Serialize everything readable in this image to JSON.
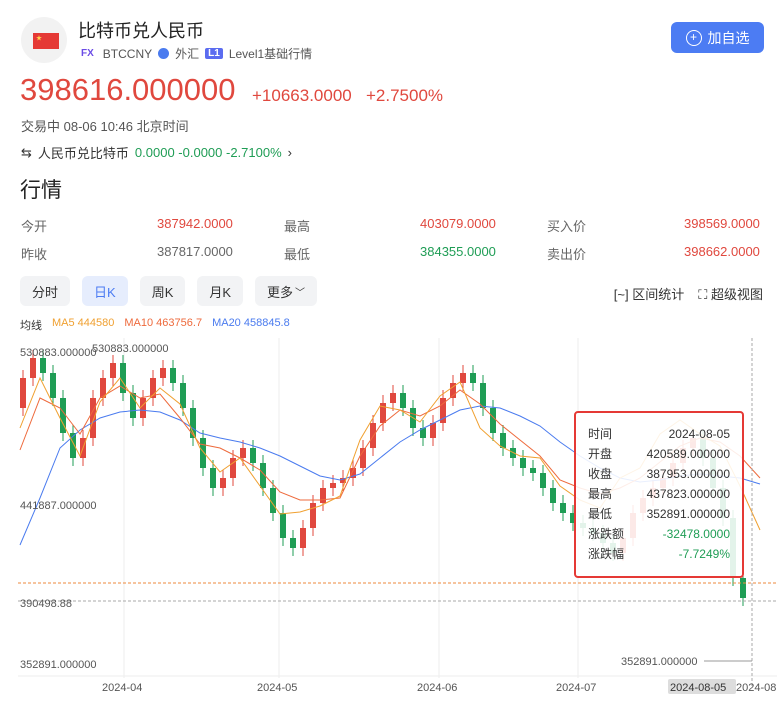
{
  "header": {
    "title": "比特币兑人民币",
    "fx_badge": "FX",
    "symbol": "BTCCNY",
    "market": "外汇",
    "level_badge": "L1",
    "level": "Level1基础行情",
    "add_label": "加自选"
  },
  "quote": {
    "price": "398616.000000",
    "change": "+10663.0000",
    "change_pct": "+2.7500%",
    "status": "交易中 08-06 10:46 北京时间",
    "inverse_label": "人民币兑比特币",
    "inverse_values": "0.0000 -0.0000 -2.7100%"
  },
  "section_title": "行情",
  "stats": [
    {
      "label": "今开",
      "value": "387942.0000",
      "color": "red"
    },
    {
      "label": "最高",
      "value": "403079.0000",
      "color": "red"
    },
    {
      "label": "买入价",
      "value": "398569.0000",
      "color": "red"
    },
    {
      "label": "昨收",
      "value": "387817.0000",
      "color": "gray"
    },
    {
      "label": "最低",
      "value": "384355.0000",
      "color": "green"
    },
    {
      "label": "卖出价",
      "value": "398662.0000",
      "color": "red"
    }
  ],
  "tabs": [
    "分时",
    "日K",
    "周K",
    "月K",
    "更多"
  ],
  "tools": {
    "range": "区间统计",
    "super": "超级视图"
  },
  "ma": {
    "label": "均线",
    "ma5": "MA5 444580",
    "ma10": "MA10 463756.7",
    "ma20": "MA20 458845.8",
    "colors": {
      "ma5": "#f0a030",
      "ma10": "#ee6a3c",
      "ma20": "#4a7bef"
    }
  },
  "axis": {
    "y_top": "530883.000000",
    "y_top_mark": "530883.000000",
    "y_mid": "441887.000000",
    "y_current": "390498.88",
    "y_bottom": "352891.000000",
    "low_mark": "352891.000000",
    "x_ticks": [
      "2024-04",
      "2024-05",
      "2024-06",
      "2024-07",
      "2024-08"
    ],
    "cursor_date": "2024-08-05"
  },
  "tooltip": [
    {
      "label": "时间",
      "value": "2024-08-05",
      "color": "dark"
    },
    {
      "label": "开盘",
      "value": "420589.000000",
      "color": "dark"
    },
    {
      "label": "收盘",
      "value": "387953.000000",
      "color": "dark"
    },
    {
      "label": "最高",
      "value": "437823.000000",
      "color": "dark"
    },
    {
      "label": "最低",
      "value": "352891.000000",
      "color": "dark"
    },
    {
      "label": "涨跌额",
      "value": "-32478.0000",
      "color": "green"
    },
    {
      "label": "涨跌幅",
      "value": "-7.7249%",
      "color": "green"
    }
  ],
  "colors": {
    "up": "#e0483e",
    "down": "#1f9d55",
    "accent": "#4c7cf3"
  }
}
